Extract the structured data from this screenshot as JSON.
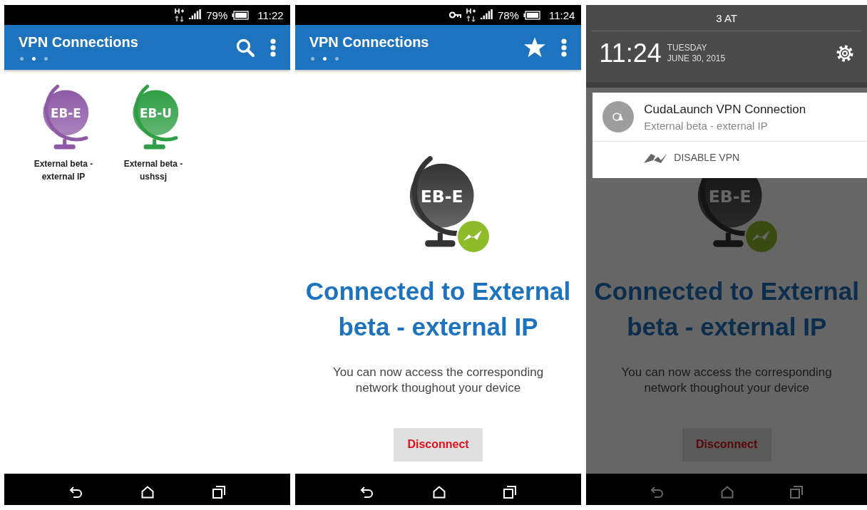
{
  "screens": [
    {
      "kind": "list",
      "status_bar": {
        "vpn_key": false,
        "battery": "79%",
        "time": "11:22"
      },
      "app_bar": {
        "title": "VPN Connections",
        "action": {
          "kind": "search"
        },
        "pages": [
          {
            "selected": false
          },
          {
            "selected": true
          },
          {
            "selected": false
          }
        ]
      },
      "connections": [
        {
          "label": "EB-E",
          "name": "External beta - external IP",
          "color": "#8e5aa6"
        },
        {
          "label": "EB-U",
          "name": "External beta - ushssj",
          "color": "#2f9e44"
        }
      ]
    },
    {
      "kind": "connected",
      "status_bar": {
        "vpn_key": true,
        "battery": "78%",
        "time": "11:24"
      },
      "app_bar": {
        "title": "VPN Connections",
        "action": {
          "kind": "star"
        },
        "pages": [
          {
            "selected": false
          },
          {
            "selected": true
          },
          {
            "selected": false
          }
        ]
      },
      "connection": {
        "label": "EB-E",
        "heading": "Connected to External beta - external IP",
        "message": "You can now access the corresponding network thoughout your device",
        "button": "Disconnect"
      }
    },
    {
      "kind": "shade",
      "shade": {
        "carrier": "3 AT",
        "time": "11:24",
        "day": "TUESDAY",
        "date": "JUNE 30, 2015",
        "notification": {
          "title": "CudaLaunch VPN Connection",
          "text": "External beta - external IP",
          "action": "DISABLE VPN"
        }
      },
      "connection": {
        "label": "EB-E",
        "heading": "Connected to External beta - external IP",
        "message": "You can now access the corresponding network thoughout your device",
        "button": "Disconnect"
      }
    }
  ]
}
